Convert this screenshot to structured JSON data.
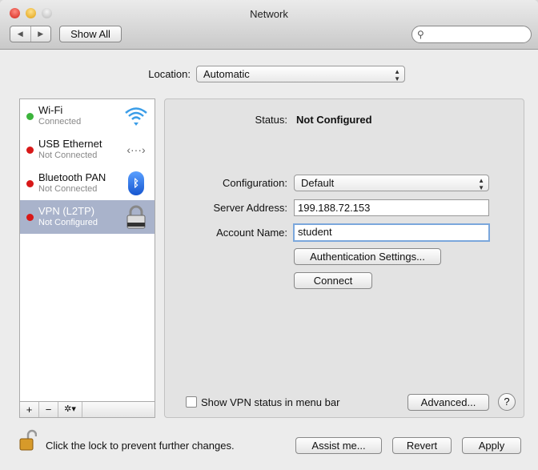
{
  "window": {
    "title": "Network",
    "show_all": "Show All",
    "search_placeholder": ""
  },
  "location": {
    "label": "Location:",
    "value": "Automatic"
  },
  "services": [
    {
      "name": "Wi-Fi",
      "status": "Connected",
      "dot": "#3cb43c",
      "icon": "wifi-icon"
    },
    {
      "name": "USB Ethernet",
      "status": "Not Connected",
      "dot": "#d81818",
      "icon": "ethernet-icon"
    },
    {
      "name": "Bluetooth PAN",
      "status": "Not Connected",
      "dot": "#d81818",
      "icon": "bluetooth-icon"
    },
    {
      "name": "VPN (L2TP)",
      "status": "Not Configured",
      "dot": "#d81818",
      "icon": "lock-icon"
    }
  ],
  "sidebar_buttons": {
    "add": "+",
    "remove": "−",
    "action": "✲▾"
  },
  "detail": {
    "status_label": "Status:",
    "status_value": "Not Configured",
    "configuration_label": "Configuration:",
    "configuration_value": "Default",
    "server_label": "Server Address:",
    "server_value": "199.188.72.153",
    "account_label": "Account Name:",
    "account_value": "student",
    "auth_button": "Authentication Settings...",
    "connect_button": "Connect",
    "show_vpn_status": "Show VPN status in menu bar",
    "advanced_button": "Advanced...",
    "help": "?"
  },
  "footer": {
    "lock_text": "Click the lock to prevent further changes.",
    "assist": "Assist me...",
    "revert": "Revert",
    "apply": "Apply"
  }
}
